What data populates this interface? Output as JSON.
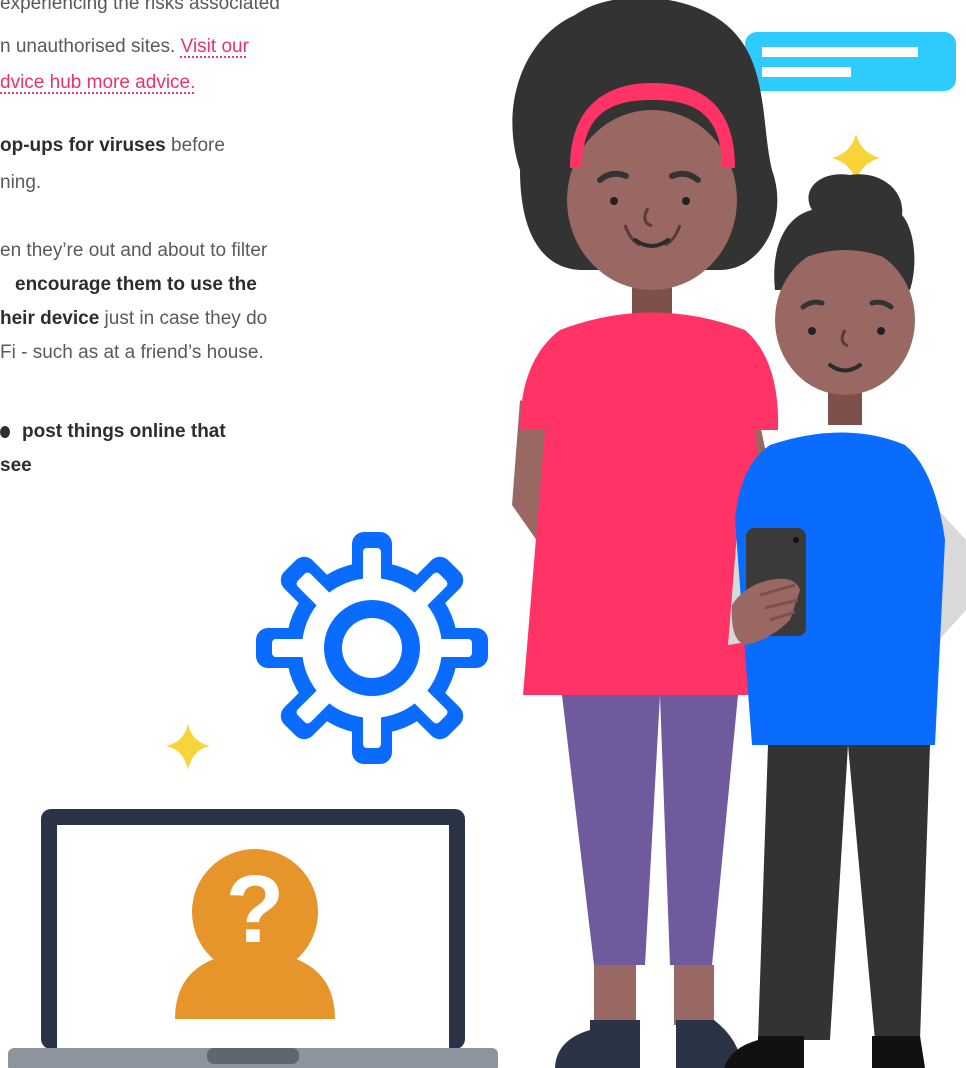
{
  "article": {
    "p1": {
      "line1": "experiencing the risks associated",
      "line2_text": "n unauthorised sites. ",
      "line2_link": "Visit our",
      "line3_link": "dvice hub more advice."
    },
    "p2": {
      "line1_bold": "op-ups for viruses",
      "line1_rest": " before",
      "line2": "ning."
    },
    "p3": {
      "line1": "en they’re out and about to filter",
      "line2_bold": "encourage them to use the",
      "line3_bold": "heir device",
      "line3_rest": " just in case they do",
      "line4": "Fi - such as at a friend’s house."
    },
    "p4": {
      "line1_bold": "post things online that",
      "line2_bold": "see"
    }
  },
  "illustration": {
    "laptop_symbol": "?",
    "icons": [
      "gear-icon",
      "sparkle-icon",
      "speech-bubble-icon",
      "smartphone-icon",
      "user-unknown-icon"
    ],
    "colors": {
      "link": "#e8336d",
      "gear": "#0a6cff",
      "sparkle": "#f7d43a",
      "bubble": "#2ecbff",
      "laptop_frame": "#2b3346",
      "question_avatar": "#e6952a",
      "dress": "#ff3366",
      "shirt": "#0a6cff",
      "hair": "#333333",
      "skin": "#9a6863",
      "leggings": "#6e5a9c"
    }
  }
}
